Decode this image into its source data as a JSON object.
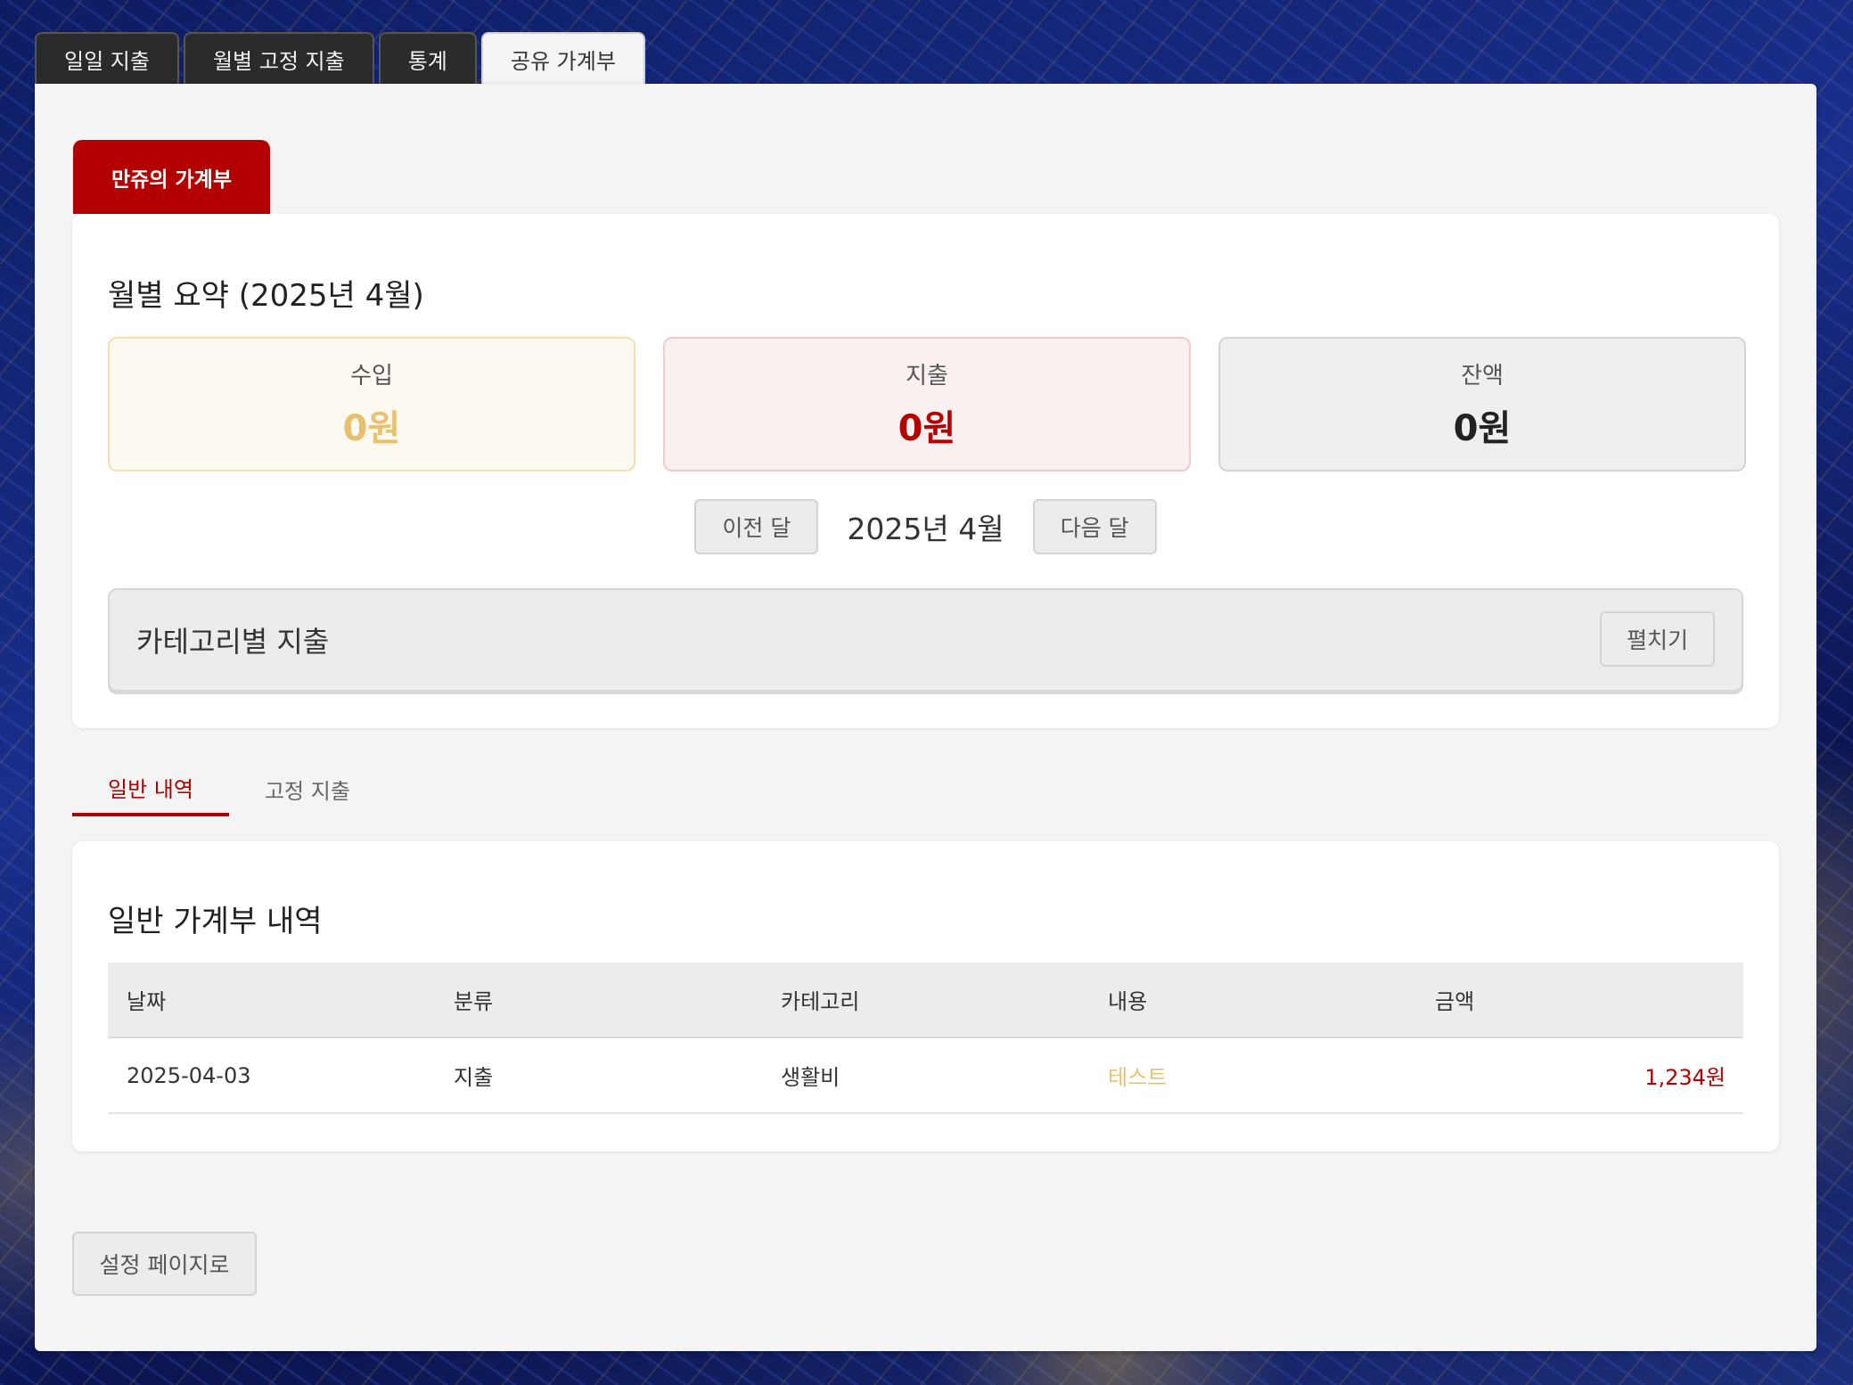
{
  "top_tabs": [
    {
      "label": "일일 지출"
    },
    {
      "label": "월별 고정 지출"
    },
    {
      "label": "통계"
    },
    {
      "label": "공유 가계부"
    }
  ],
  "book": {
    "name": "만쥬의 가계부"
  },
  "summary": {
    "title": "월별 요약 (2025년 4월)",
    "income": {
      "label": "수입",
      "value": "0원"
    },
    "expense": {
      "label": "지출",
      "value": "0원"
    },
    "balance": {
      "label": "잔액",
      "value": "0원"
    }
  },
  "month_nav": {
    "prev": "이전 달",
    "current": "2025년 4월",
    "next": "다음 달"
  },
  "category": {
    "title": "카테고리별 지출",
    "expand": "펼치기"
  },
  "sub_tabs": [
    {
      "label": "일반 내역"
    },
    {
      "label": "고정 지출"
    }
  ],
  "list": {
    "title": "일반 가계부 내역",
    "columns": [
      "날짜",
      "분류",
      "카테고리",
      "내용",
      "금액"
    ],
    "rows": [
      {
        "date": "2025-04-03",
        "type": "지출",
        "category": "생활비",
        "desc": "테스트",
        "amount": "1,234원"
      }
    ]
  },
  "settings_button": "설정 페이지로",
  "colors": {
    "accent": "#b30000",
    "income": "#e8c06e",
    "dark_tab": "#2b2b2b"
  }
}
